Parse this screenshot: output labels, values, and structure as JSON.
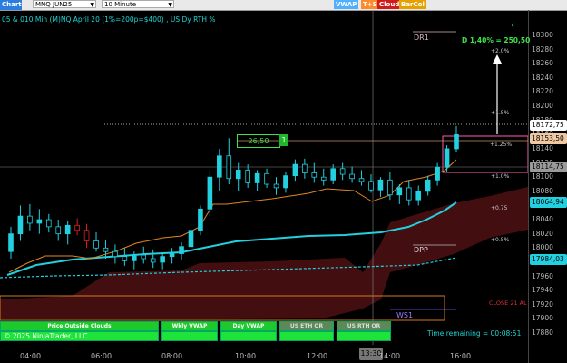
{
  "toolbar": {
    "chart_label": "Chart",
    "instrument": "MNQ JUN25",
    "interval": "10 Minute",
    "tags": [
      {
        "label": "VWAP",
        "color": "#4fb0ff"
      },
      {
        "label": "T+S",
        "color": "#ff8a2a"
      },
      {
        "label": "Cloud",
        "color": "#d21a1a"
      },
      {
        "label": "BarCol",
        "color": "#e6a000"
      }
    ]
  },
  "chart_title": "05 & 010 Min (M)NQ  April 20 (1%=200p=$400) , US Dy RTH %",
  "copyright": "© 2025 NinjaTrader, LLC",
  "time_remaining": "Time remaining = 00:08:51",
  "crosshair_time": "13:30",
  "annotations": {
    "dr1": "DR1",
    "dpp": "DPP",
    "ws1": "WS1",
    "close": "CLOSE 21 AL",
    "delta": "D 1,40% = 250,50",
    "pct_labels": [
      "+2.0%",
      "+1.5%",
      "+1.25%",
      "+1.0%",
      "+0.75",
      "+0.5%"
    ],
    "ruler_value": "26,50",
    "ruler_count": "1"
  },
  "buttons": [
    {
      "label": "Price Outside Clouds"
    },
    {
      "label": "Wkly VWAP"
    },
    {
      "label": "Day VWAP"
    },
    {
      "label": "US ETH OR"
    },
    {
      "label": "US RTH OR"
    }
  ],
  "chart_data": {
    "type": "candlestick",
    "x_ticks": [
      "04:00",
      "06:00",
      "08:00",
      "10:00",
      "12:00",
      "14:00",
      "16:00"
    ],
    "y_ticks": [
      18300,
      18280,
      18260,
      18240,
      18220,
      18200,
      18180,
      18160,
      18140,
      18120,
      18100,
      18080,
      18060,
      18040,
      18020,
      18000,
      17980,
      17960,
      17940,
      17920,
      17900,
      17880
    ],
    "ylim": [
      17870,
      18310
    ],
    "price_boxes": [
      {
        "label": "18172,75",
        "bg": "#ffffff",
        "fg": "#000000"
      },
      {
        "label": "18153,50",
        "bg": "#f0c9a2",
        "fg": "#000000"
      },
      {
        "label": "18114,75",
        "bg": "#9a9a9a",
        "fg": "#000000"
      },
      {
        "label": "18064,94",
        "bg": "#22d0e0",
        "fg": "#000000"
      },
      {
        "label": "17984,03",
        "bg": "#22d0e0",
        "fg": "#000000"
      }
    ],
    "candles": [
      {
        "o": 17995,
        "h": 18030,
        "l": 17985,
        "c": 18020
      },
      {
        "o": 18020,
        "h": 18060,
        "l": 18010,
        "c": 18045
      },
      {
        "o": 18045,
        "h": 18062,
        "l": 18025,
        "c": 18035
      },
      {
        "o": 18035,
        "h": 18055,
        "l": 18020,
        "c": 18040
      },
      {
        "o": 18040,
        "h": 18048,
        "l": 18022,
        "c": 18030
      },
      {
        "o": 18030,
        "h": 18040,
        "l": 18010,
        "c": 18020
      },
      {
        "o": 18020,
        "h": 18038,
        "l": 18005,
        "c": 18032
      },
      {
        "o": 18032,
        "h": 18042,
        "l": 18018,
        "c": 18025
      },
      {
        "o": 18025,
        "h": 18034,
        "l": 18000,
        "c": 18010
      },
      {
        "o": 18010,
        "h": 18022,
        "l": 17995,
        "c": 18000
      },
      {
        "o": 18000,
        "h": 18012,
        "l": 17985,
        "c": 17995
      },
      {
        "o": 17995,
        "h": 18005,
        "l": 17978,
        "c": 17988
      },
      {
        "o": 17988,
        "h": 18000,
        "l": 17975,
        "c": 17982
      },
      {
        "o": 17982,
        "h": 17995,
        "l": 17970,
        "c": 17990
      },
      {
        "o": 17990,
        "h": 18002,
        "l": 17978,
        "c": 17985
      },
      {
        "o": 17985,
        "h": 17998,
        "l": 17972,
        "c": 17980
      },
      {
        "o": 17980,
        "h": 17994,
        "l": 17970,
        "c": 17988
      },
      {
        "o": 17988,
        "h": 18000,
        "l": 17978,
        "c": 17992
      },
      {
        "o": 17992,
        "h": 18008,
        "l": 17984,
        "c": 18002
      },
      {
        "o": 18002,
        "h": 18030,
        "l": 17996,
        "c": 18025
      },
      {
        "o": 18025,
        "h": 18060,
        "l": 18018,
        "c": 18055
      },
      {
        "o": 18055,
        "h": 18110,
        "l": 18045,
        "c": 18100
      },
      {
        "o": 18100,
        "h": 18140,
        "l": 18080,
        "c": 18130
      },
      {
        "o": 18130,
        "h": 18155,
        "l": 18090,
        "c": 18098
      },
      {
        "o": 18098,
        "h": 18120,
        "l": 18080,
        "c": 18110
      },
      {
        "o": 18110,
        "h": 18118,
        "l": 18085,
        "c": 18092
      },
      {
        "o": 18092,
        "h": 18110,
        "l": 18080,
        "c": 18105
      },
      {
        "o": 18105,
        "h": 18112,
        "l": 18085,
        "c": 18090
      },
      {
        "o": 18090,
        "h": 18100,
        "l": 18075,
        "c": 18085
      },
      {
        "o": 18085,
        "h": 18108,
        "l": 18078,
        "c": 18102
      },
      {
        "o": 18102,
        "h": 18125,
        "l": 18095,
        "c": 18118
      },
      {
        "o": 18118,
        "h": 18126,
        "l": 18098,
        "c": 18106
      },
      {
        "o": 18106,
        "h": 18120,
        "l": 18092,
        "c": 18100
      },
      {
        "o": 18100,
        "h": 18112,
        "l": 18088,
        "c": 18096
      },
      {
        "o": 18096,
        "h": 18118,
        "l": 18090,
        "c": 18112
      },
      {
        "o": 18112,
        "h": 18120,
        "l": 18096,
        "c": 18104
      },
      {
        "o": 18104,
        "h": 18115,
        "l": 18092,
        "c": 18098
      },
      {
        "o": 18098,
        "h": 18110,
        "l": 18088,
        "c": 18094
      },
      {
        "o": 18094,
        "h": 18104,
        "l": 18078,
        "c": 18082
      },
      {
        "o": 18082,
        "h": 18100,
        "l": 18072,
        "c": 18096
      },
      {
        "o": 18096,
        "h": 18108,
        "l": 18068,
        "c": 18075
      },
      {
        "o": 18075,
        "h": 18090,
        "l": 18062,
        "c": 18085
      },
      {
        "o": 18085,
        "h": 18096,
        "l": 18060,
        "c": 18068
      },
      {
        "o": 18068,
        "h": 18088,
        "l": 18060,
        "c": 18080
      },
      {
        "o": 18080,
        "h": 18102,
        "l": 18074,
        "c": 18096
      },
      {
        "o": 18096,
        "h": 18120,
        "l": 18088,
        "c": 18114
      },
      {
        "o": 18114,
        "h": 18145,
        "l": 18108,
        "c": 18140
      },
      {
        "o": 18140,
        "h": 18172,
        "l": 18135,
        "c": 18160
      }
    ]
  }
}
